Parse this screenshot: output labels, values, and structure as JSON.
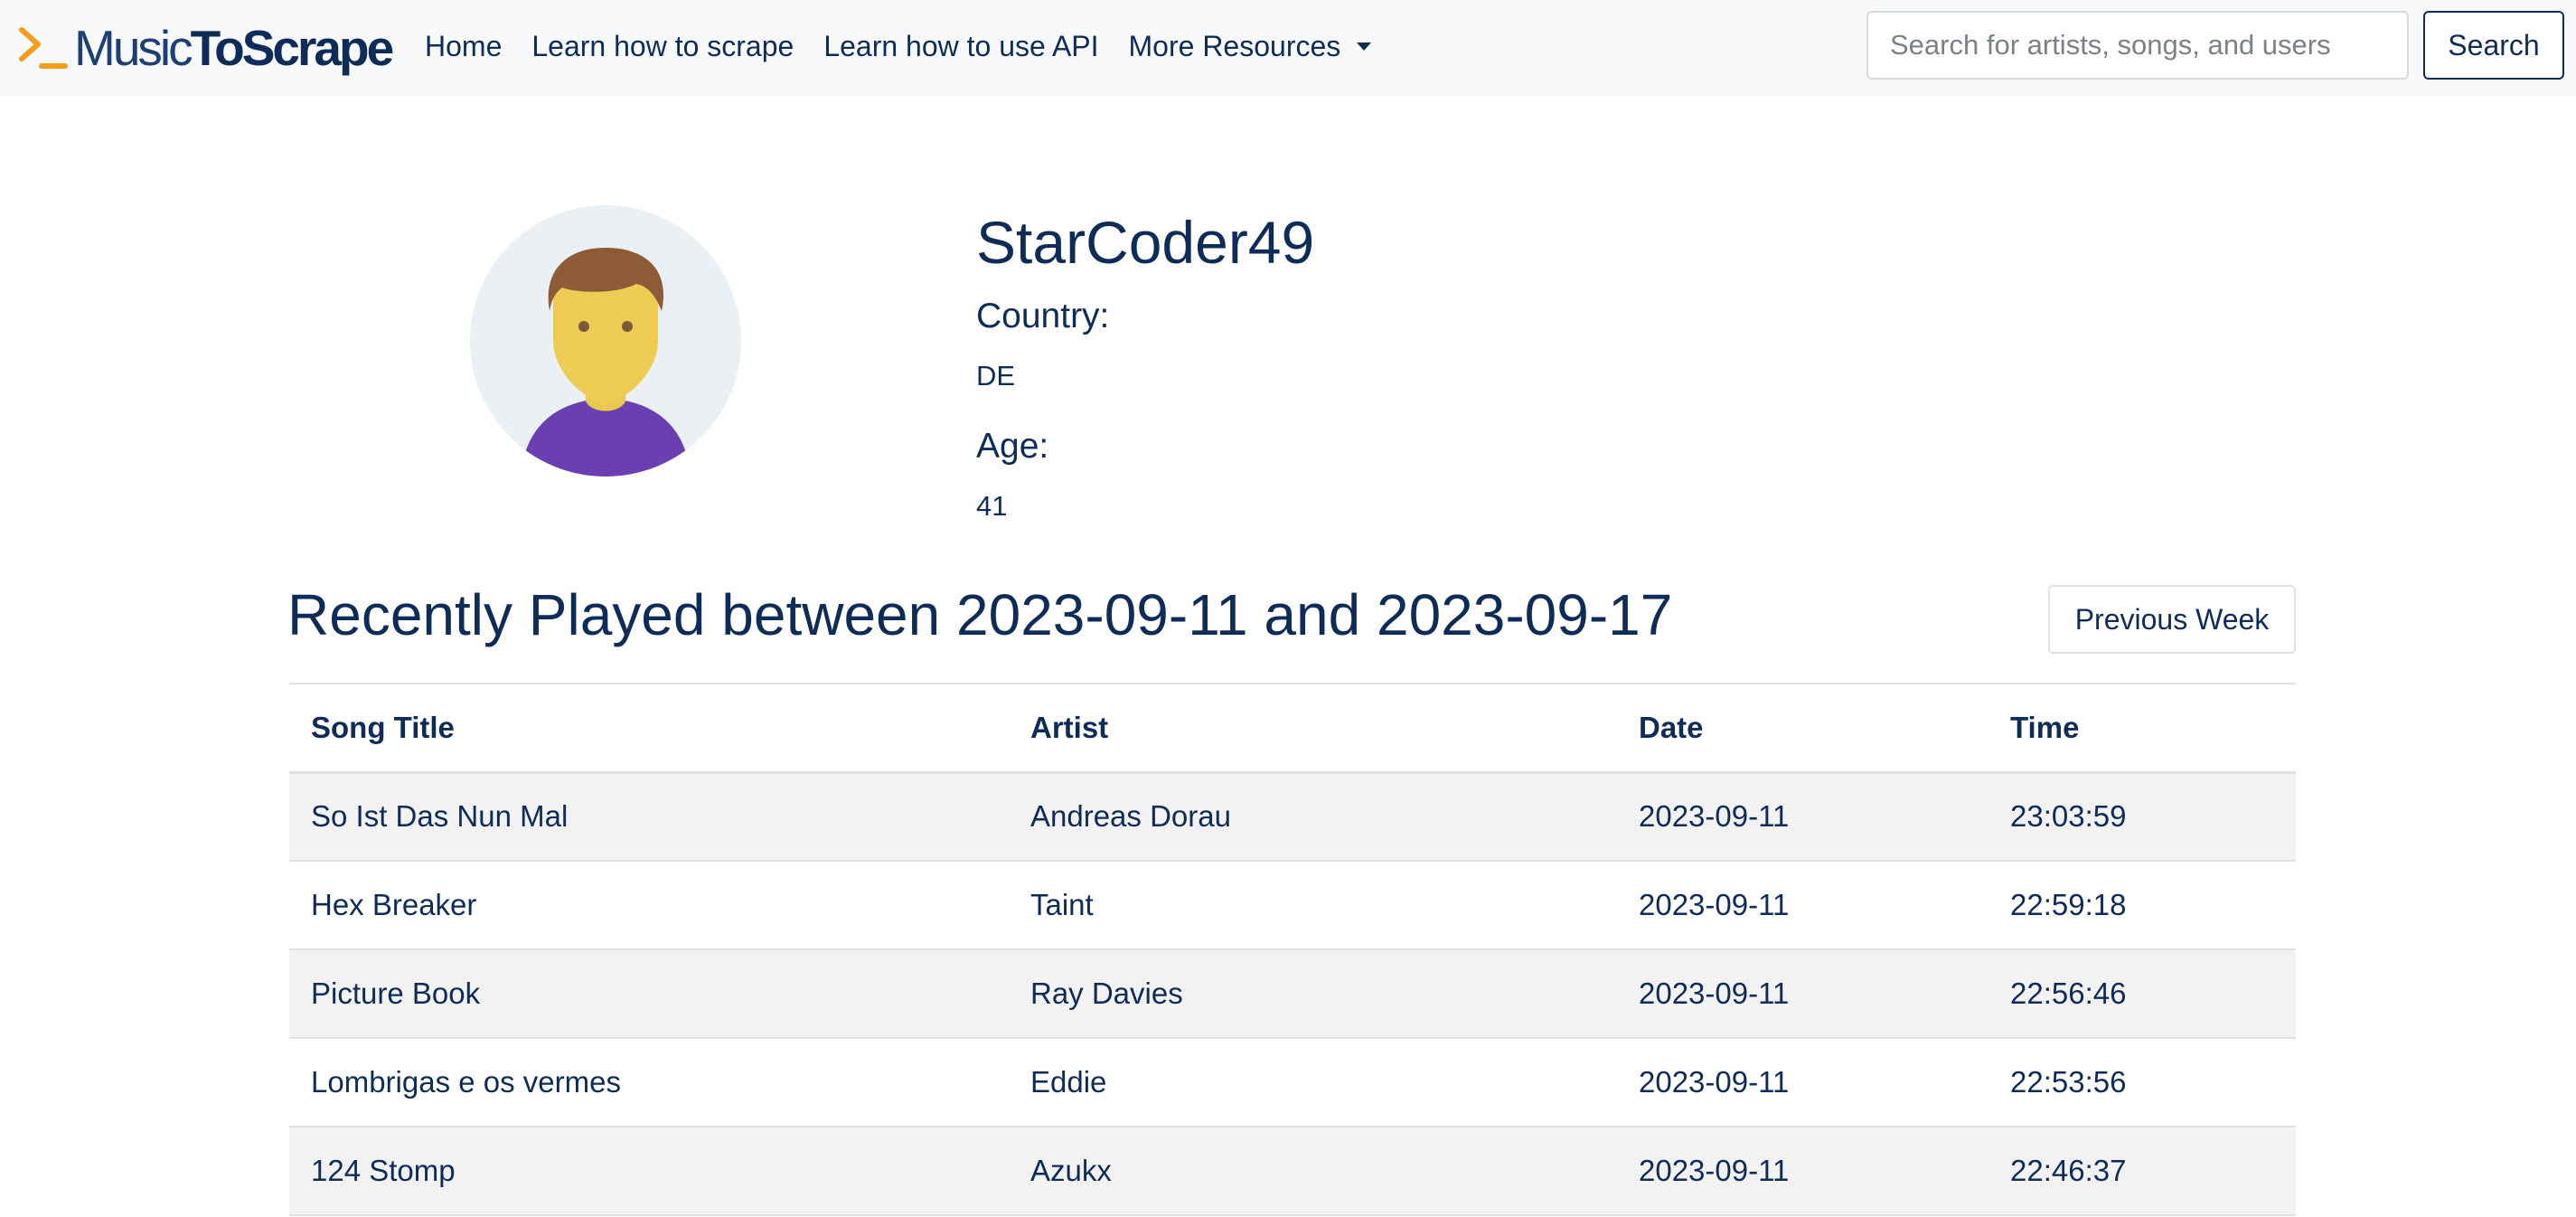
{
  "colors": {
    "navy": "#0f2c59",
    "accent_orange": "#f29e1c",
    "navbar_bg": "#f8f9fa",
    "row_stripe": "#f2f2f2"
  },
  "brand": {
    "logo_icon": "terminal-prompt-icon",
    "light": "Music",
    "bold": "ToScrape"
  },
  "nav": {
    "home": "Home",
    "learn_scrape": "Learn how to scrape",
    "learn_api": "Learn how to use API",
    "more_resources": "More Resources"
  },
  "search": {
    "placeholder": "Search for artists, songs, and users",
    "value": "",
    "button_label": "Search"
  },
  "profile": {
    "avatar_icon": "user-avatar-icon",
    "username": "StarCoder49",
    "country_label": "Country:",
    "country": "DE",
    "age_label": "Age:",
    "age": "41"
  },
  "recent": {
    "title": "Recently Played between 2023-09-11 and 2023-09-17",
    "prev_week_label": "Previous Week",
    "columns": [
      "Song Title",
      "Artist",
      "Date",
      "Time"
    ],
    "rows": [
      [
        "So Ist Das Nun Mal",
        "Andreas Dorau",
        "2023-09-11",
        "23:03:59"
      ],
      [
        "Hex Breaker",
        "Taint",
        "2023-09-11",
        "22:59:18"
      ],
      [
        "Picture Book",
        "Ray Davies",
        "2023-09-11",
        "22:56:46"
      ],
      [
        "Lombrigas e os vermes",
        "Eddie",
        "2023-09-11",
        "22:53:56"
      ],
      [
        "124 Stomp",
        "Azukx",
        "2023-09-11",
        "22:46:37"
      ]
    ]
  }
}
